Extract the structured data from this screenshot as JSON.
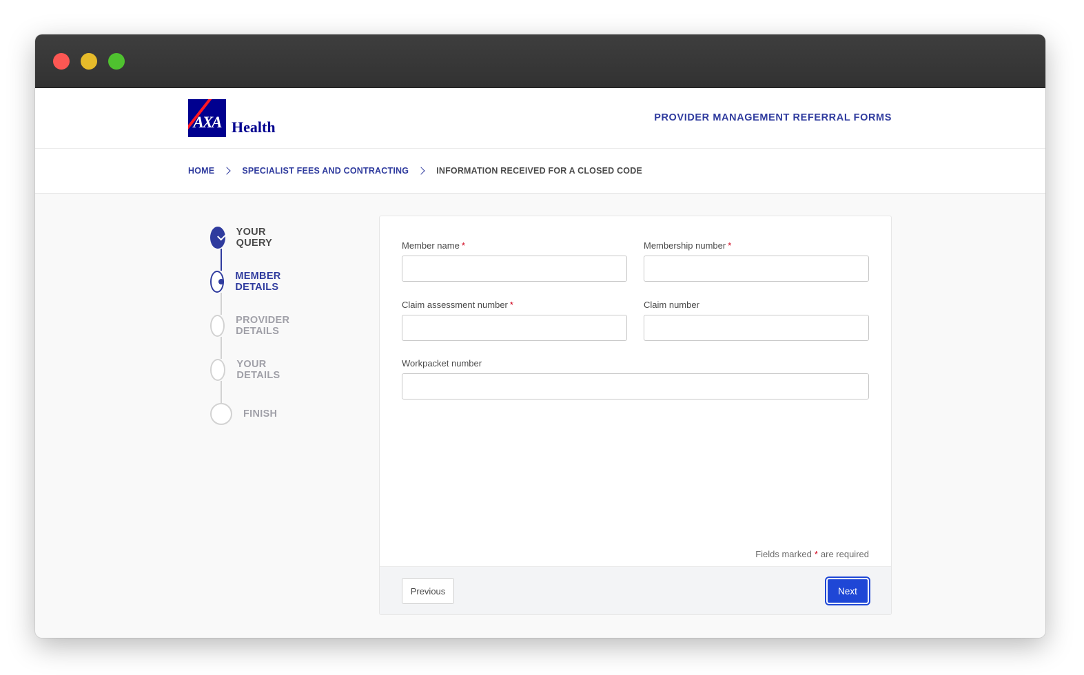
{
  "header": {
    "logo_mark": "AXA",
    "logo_text": "Health",
    "title": "PROVIDER MANAGEMENT REFERRAL FORMS"
  },
  "breadcrumb": {
    "home": "HOME",
    "section": "SPECIALIST FEES AND CONTRACTING",
    "current": "INFORMATION RECEIVED FOR A CLOSED CODE"
  },
  "steps": [
    {
      "label": "YOUR QUERY",
      "state": "complete"
    },
    {
      "label": "MEMBER DETAILS",
      "state": "active"
    },
    {
      "label": "PROVIDER DETAILS",
      "state": "pending"
    },
    {
      "label": "YOUR DETAILS",
      "state": "pending"
    },
    {
      "label": "FINISH",
      "state": "pending"
    }
  ],
  "form": {
    "member_name": {
      "label": "Member name",
      "required_mark": "*",
      "value": ""
    },
    "membership_number": {
      "label": "Membership number",
      "required_mark": "*",
      "value": ""
    },
    "claim_assessment_number": {
      "label": "Claim assessment number",
      "required_mark": "*",
      "value": ""
    },
    "claim_number": {
      "label": "Claim number",
      "value": ""
    },
    "workpacket_number": {
      "label": "Workpacket number",
      "value": ""
    },
    "required_note_prefix": "Fields marked",
    "required_note_mark": "*",
    "required_note_suffix": "are required"
  },
  "buttons": {
    "previous": "Previous",
    "next": "Next"
  },
  "colors": {
    "brand_blue": "#00008f",
    "accent": "#2f3b9e",
    "primary_button": "#1f47d6",
    "required": "#d0021b"
  }
}
